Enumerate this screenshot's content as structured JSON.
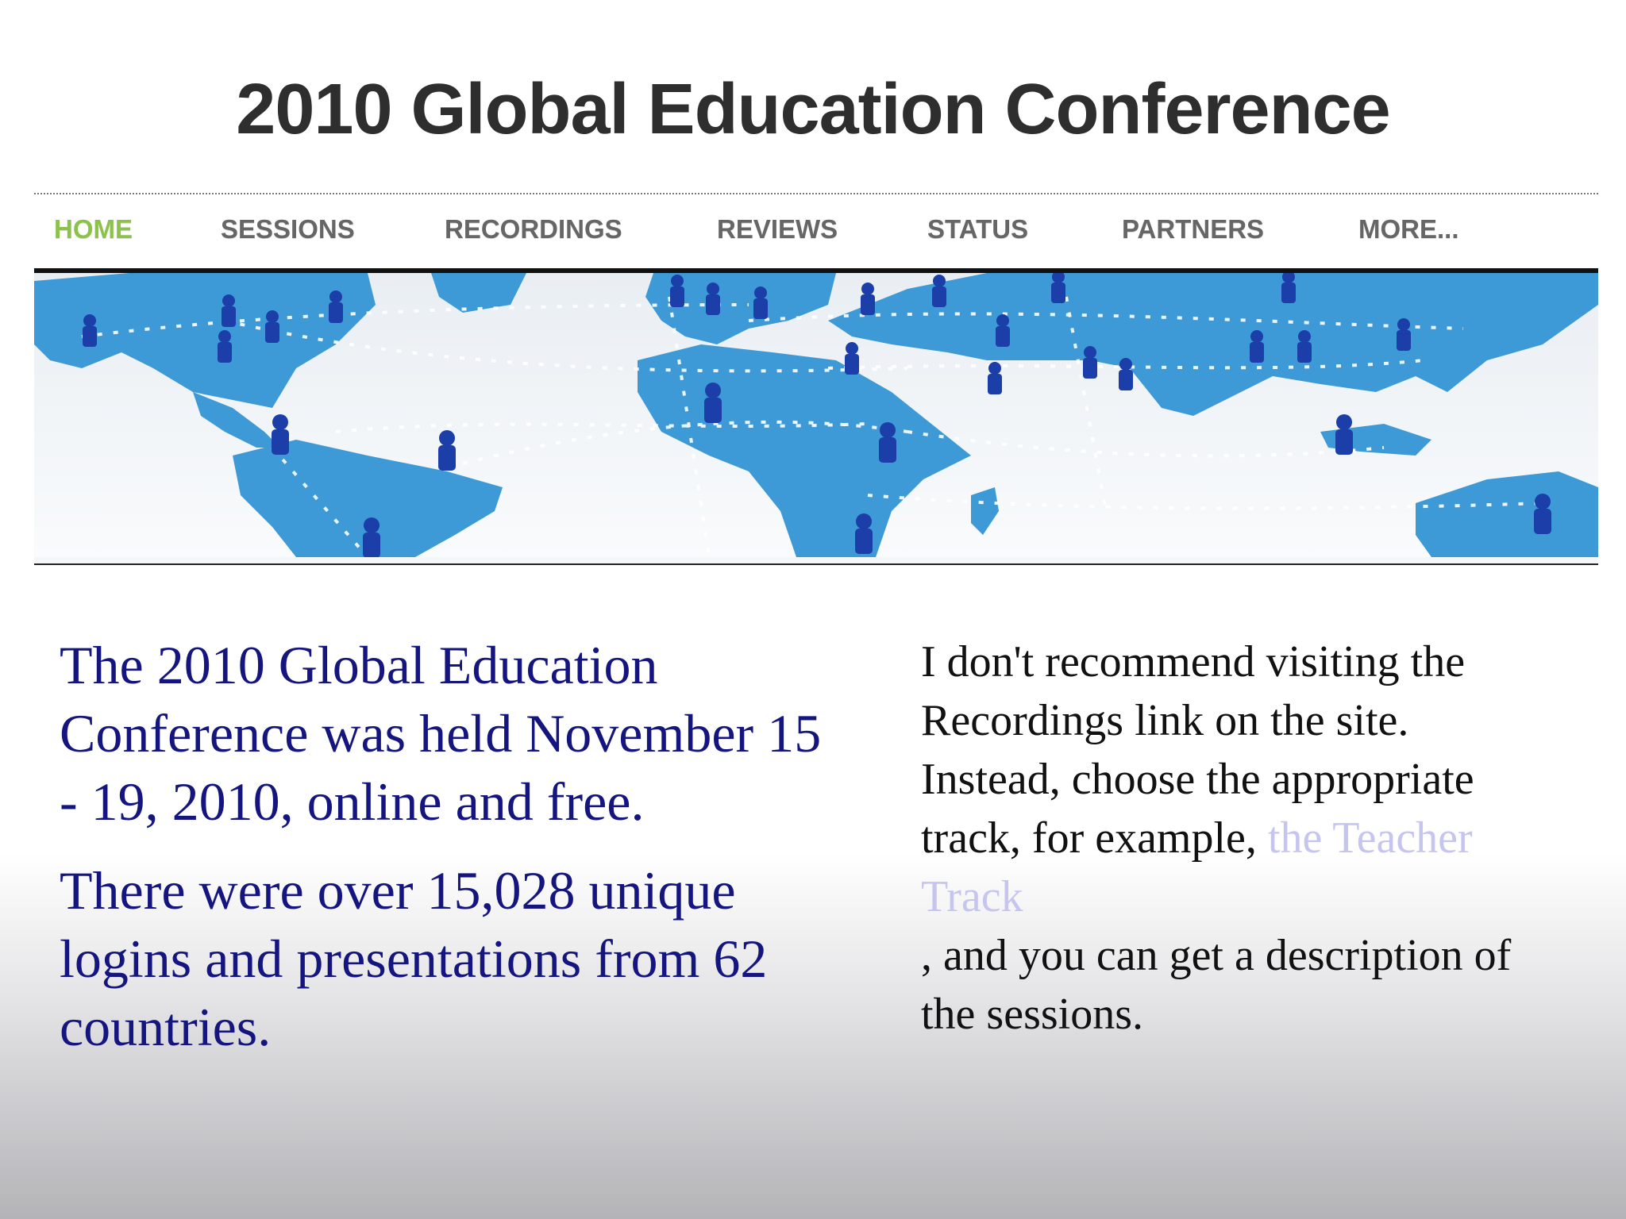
{
  "site": {
    "title": "2010 Global Education Conference"
  },
  "nav": {
    "items": [
      {
        "label": "HOME",
        "active": true
      },
      {
        "label": "SESSIONS",
        "active": false
      },
      {
        "label": "RECORDINGS",
        "active": false
      },
      {
        "label": "REVIEWS",
        "active": false
      },
      {
        "label": "STATUS",
        "active": false
      },
      {
        "label": "PARTNERS",
        "active": false
      },
      {
        "label": "MORE...",
        "active": false
      }
    ],
    "active_color": "#8bc34a",
    "inactive_color": "#666666"
  },
  "banner": {
    "description_icon": "world-map-with-people-icon",
    "land_color": "#3d9ad6",
    "marker_color": "#1b3ea8"
  },
  "left": {
    "paragraph1": "The 2010 Global Education Conference was held November 15 - 19, 2010, online and free.",
    "paragraph2": "There were over 15,028 unique logins and presentations from 62 countries."
  },
  "right": {
    "text_before": "I don't recommend visiting the Recordings link on the site.  Instead, choose the appropriate track, for example, ",
    "link_text": "the Teacher Track",
    "text_after": ", and you can get a description of the sessions."
  }
}
